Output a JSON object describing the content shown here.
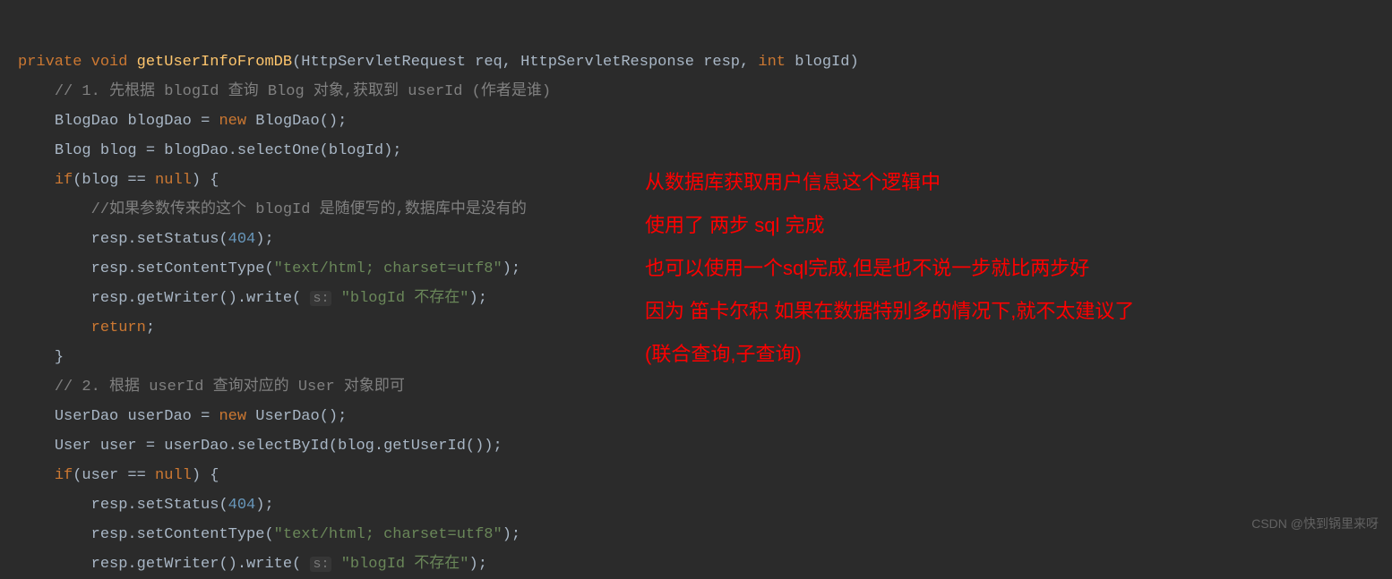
{
  "code": {
    "line1": {
      "kw1": "private",
      "kw2": "void",
      "method": "getUserInfoFromDB",
      "paren_open": "(",
      "type1": "HttpServletRequest",
      "param1": "req",
      "comma1": ",",
      "type2": "HttpServletResponse",
      "param2": "resp",
      "comma2": ",",
      "type3": "int",
      "param3": "blogId",
      "paren_close": ")"
    },
    "comment1": "// 1. 先根据 blogId 查询 Blog 对象,获取到 userId (作者是谁)",
    "line3": {
      "type": "BlogDao",
      "var": "blogDao",
      "eq": "=",
      "kw": "new",
      "ctor": "BlogDao",
      "tail": "();"
    },
    "line4": {
      "type": "Blog",
      "var": "blog",
      "eq": "=",
      "expr": "blogDao.selectOne(blogId);"
    },
    "line5": {
      "kw": "if",
      "open": "(blog ==",
      "nullkw": "null",
      "close": ") {"
    },
    "comment2": "//如果参数传来的这个 blogId 是随便写的,数据库中是没有的",
    "line7": {
      "call": "resp.setStatus(",
      "num": "404",
      "tail": ");"
    },
    "line8": {
      "call": "resp.setContentType(",
      "str": "\"text/html; charset=utf8\"",
      "tail": ");"
    },
    "line9": {
      "call": "resp.getWriter().write(",
      "hint": "s:",
      "str": "\"blogId 不存在\"",
      "tail": ");"
    },
    "line10": {
      "kw": "return",
      "semi": ";"
    },
    "line11": "}",
    "comment3": "// 2. 根据 userId 查询对应的 User 对象即可",
    "line13": {
      "type": "UserDao",
      "var": "userDao",
      "eq": "=",
      "kw": "new",
      "ctor": "UserDao",
      "tail": "();"
    },
    "line14": {
      "type": "User",
      "var": "user",
      "eq": "=",
      "expr": "userDao.selectById(blog.getUserId());"
    },
    "line15": {
      "kw": "if",
      "open": "(user ==",
      "nullkw": "null",
      "close": ") {"
    },
    "line16": {
      "call": "resp.setStatus(",
      "num": "404",
      "tail": ");"
    },
    "line17": {
      "call": "resp.setContentType(",
      "str": "\"text/html; charset=utf8\"",
      "tail": ");"
    },
    "line18": {
      "call": "resp.getWriter().write(",
      "hint": "s:",
      "str": "\"blogId 不存在\"",
      "tail": ");"
    }
  },
  "annotation": {
    "l1": "从数据库获取用户信息这个逻辑中",
    "l2": "使用了 两步 sql 完成",
    "l3": "也可以使用一个sql完成,但是也不说一步就比两步好",
    "l4": "因为 笛卡尔积 如果在数据特别多的情况下,就不太建议了",
    "l5": "(联合查询,子查询)"
  },
  "watermark": "CSDN @快到锅里来呀"
}
